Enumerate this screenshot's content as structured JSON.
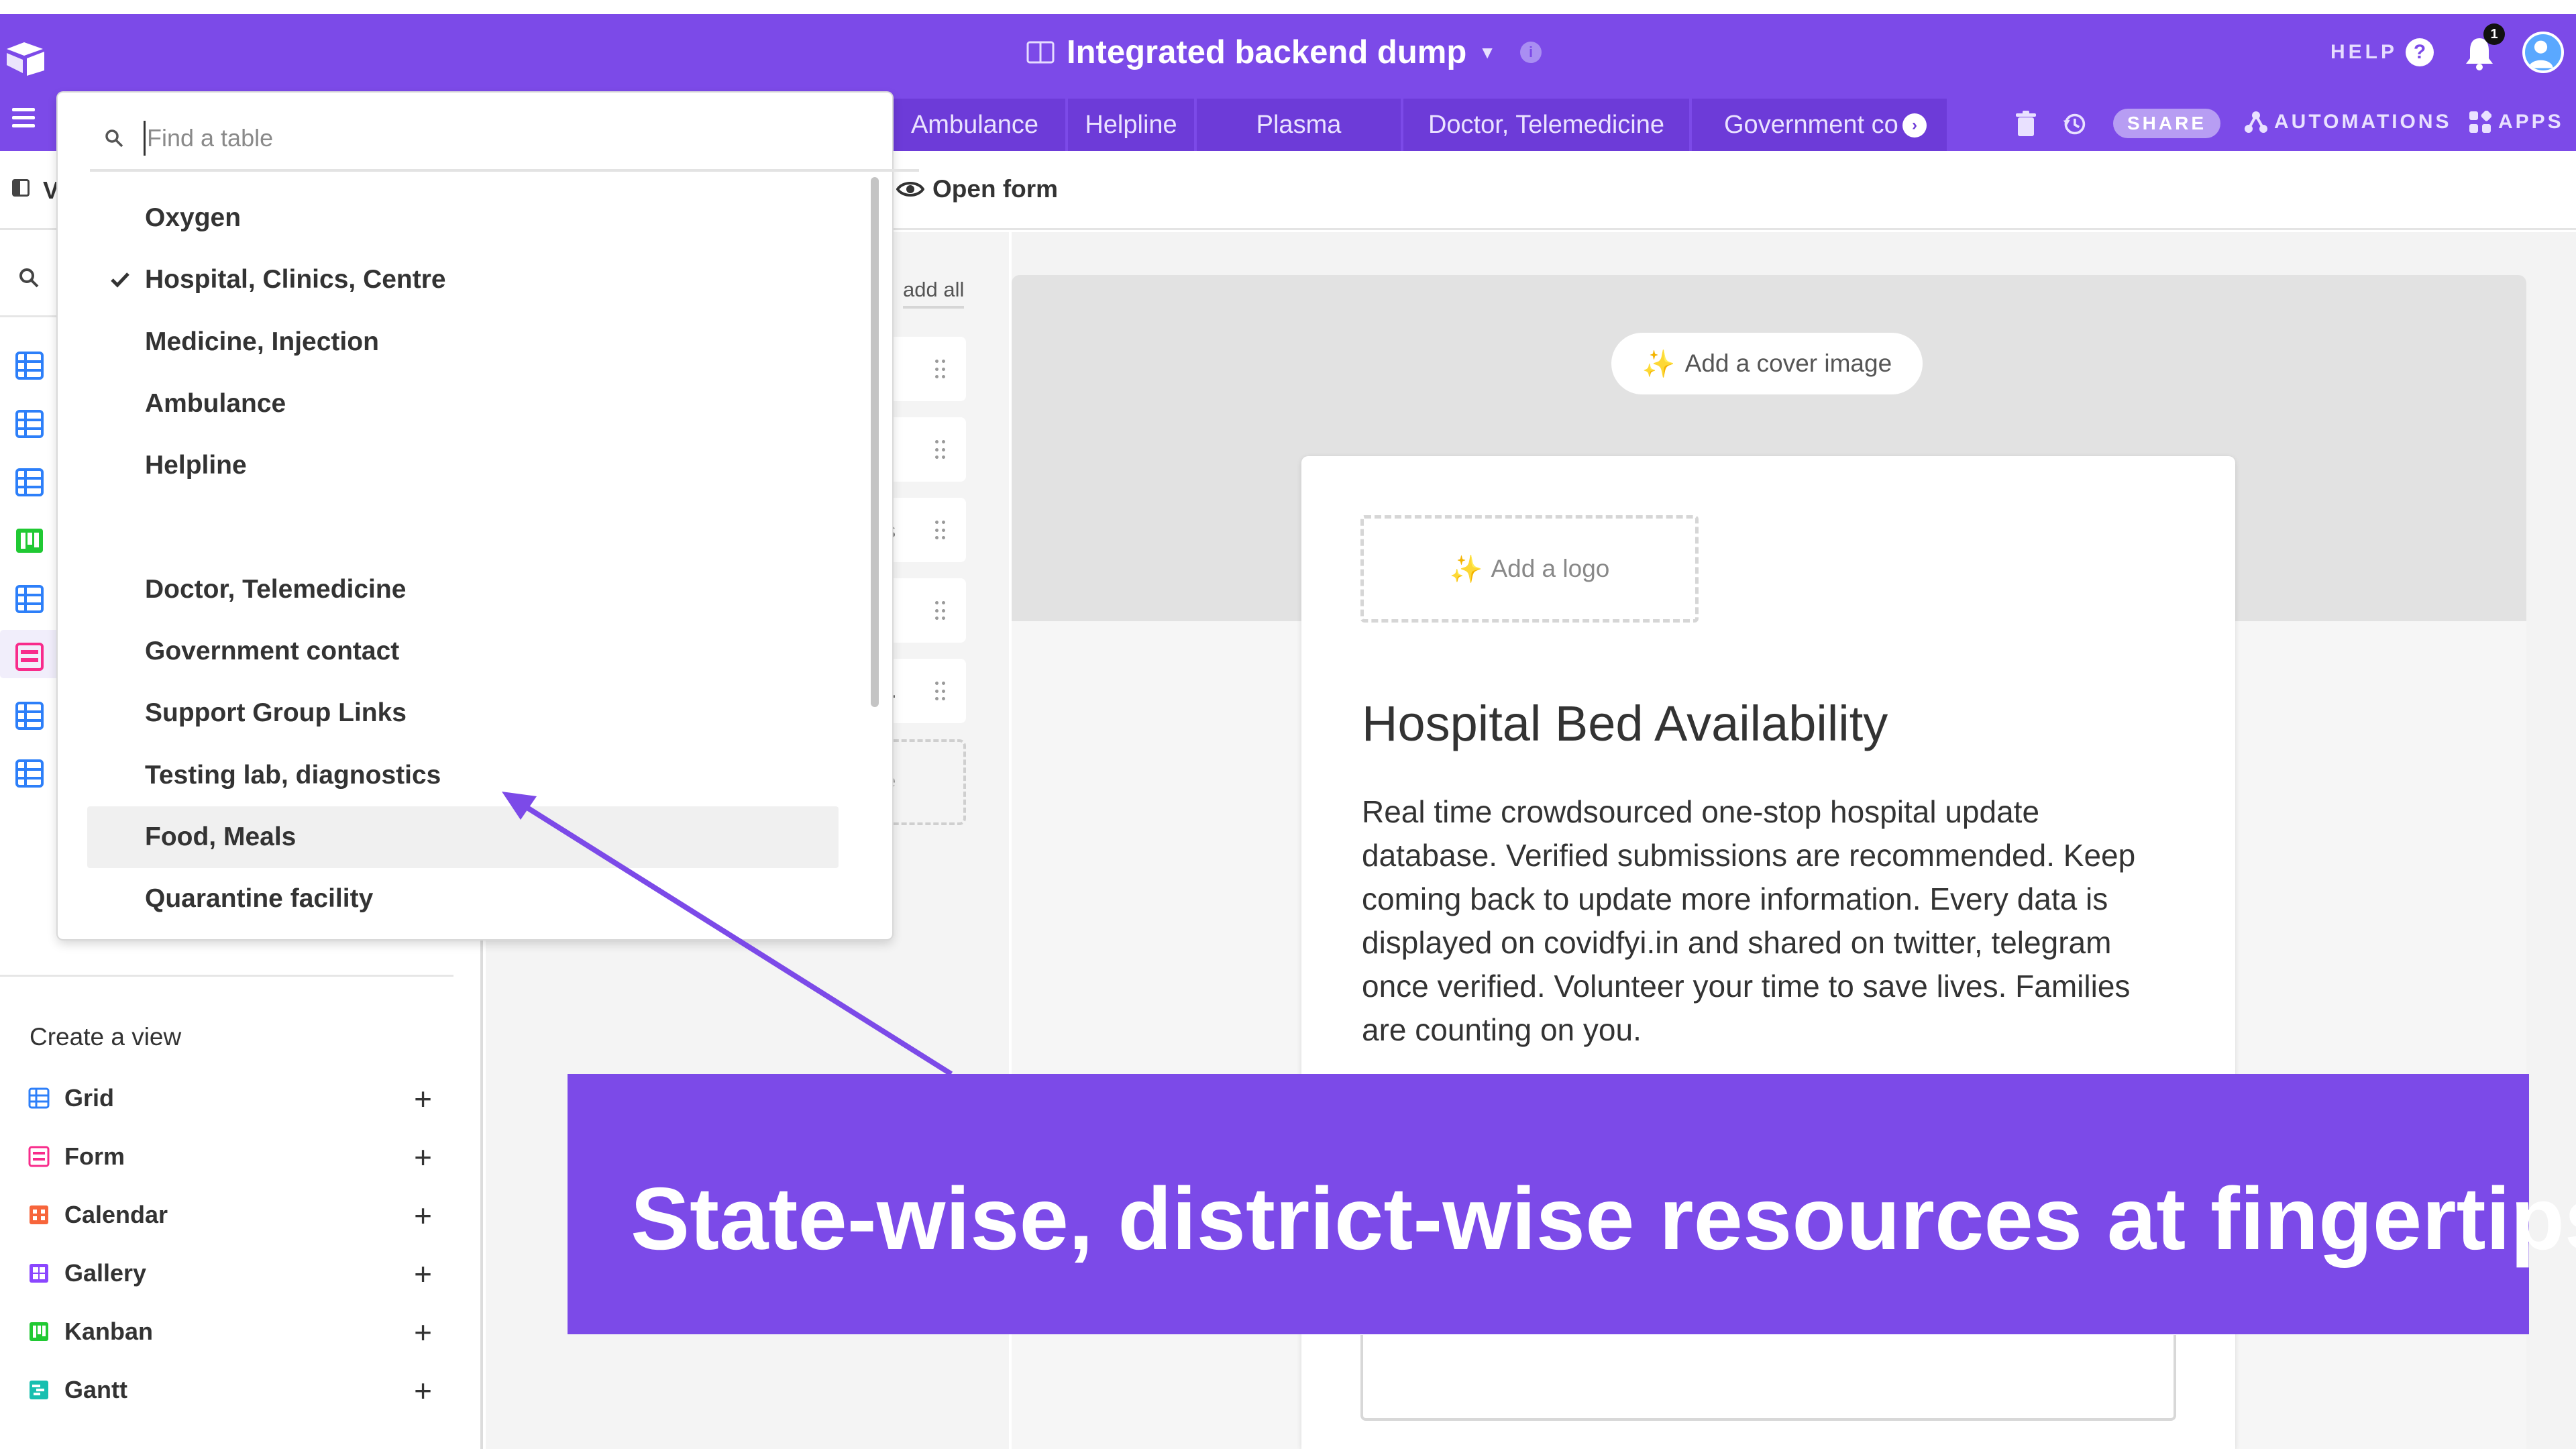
{
  "header": {
    "base_title": "Integrated backend dump",
    "help_label": "HELP",
    "notification_count": "1",
    "brand_color": "#7c4ae8"
  },
  "tabs": [
    {
      "label": "Ambulance"
    },
    {
      "label": "Helpline"
    },
    {
      "label": "Plasma"
    },
    {
      "label": "Doctor, Telemedicine"
    },
    {
      "label": "Government co"
    }
  ],
  "toolbar": {
    "share_label": "SHARE",
    "automations_label": "AUTOMATIONS",
    "apps_label": "APPS"
  },
  "viewbar": {
    "view_prefix": "V",
    "open_form_label": "Open form"
  },
  "table_finder": {
    "placeholder": "Find a table",
    "items": [
      {
        "label": "Oxygen",
        "selected": false
      },
      {
        "label": "Hospital, Clinics, Centre",
        "selected": true
      },
      {
        "label": "Medicine, Injection",
        "selected": false
      },
      {
        "label": "Ambulance",
        "selected": false
      },
      {
        "label": "Helpline",
        "selected": false
      },
      {
        "label": "",
        "selected": false
      },
      {
        "label": "Doctor, Telemedicine",
        "selected": false
      },
      {
        "label": "Government contact",
        "selected": false
      },
      {
        "label": "Support Group Links",
        "selected": false
      },
      {
        "label": "Testing lab, diagnostics",
        "selected": false
      },
      {
        "label": "Food, Meals",
        "selected": false,
        "hovered": true
      },
      {
        "label": "Quarantine facility",
        "selected": false
      }
    ]
  },
  "sidebar": {
    "view_icons": [
      "grid-icon",
      "grid-icon",
      "grid-icon",
      "kanban-icon",
      "grid-icon",
      "form-icon",
      "grid-icon",
      "grid-icon"
    ],
    "create_view_title": "Create a view",
    "create_options": [
      {
        "label": "Grid",
        "icon": "grid-icon",
        "color": "#2d7ff9"
      },
      {
        "label": "Form",
        "icon": "form-icon",
        "color": "#f82b8b"
      },
      {
        "label": "Calendar",
        "icon": "calendar-icon",
        "color": "#f7653b"
      },
      {
        "label": "Gallery",
        "icon": "gallery-icon",
        "color": "#8b46ff"
      },
      {
        "label": "Kanban",
        "icon": "kanban-icon",
        "color": "#20c933"
      },
      {
        "label": "Gantt",
        "icon": "gantt-icon",
        "color": "#18bfb0"
      }
    ]
  },
  "fields": {
    "add_all_label": "add all",
    "partial_texts": [
      "s",
      "..",
      "le"
    ]
  },
  "form": {
    "cover_label": "Add a cover image",
    "logo_label": "Add a logo",
    "title": "Hospital Bed Availability",
    "description": "Real time crowdsourced one-stop hospital update database. Verified submissions are recommended. Keep coming back to update more information. Every data is displayed on covidfyi.in and shared on twitter, telegram once verified. Volunteer your time to save lives. Families are counting on you."
  },
  "banner": {
    "text": "State-wise, district-wise resources at fingertips!"
  }
}
